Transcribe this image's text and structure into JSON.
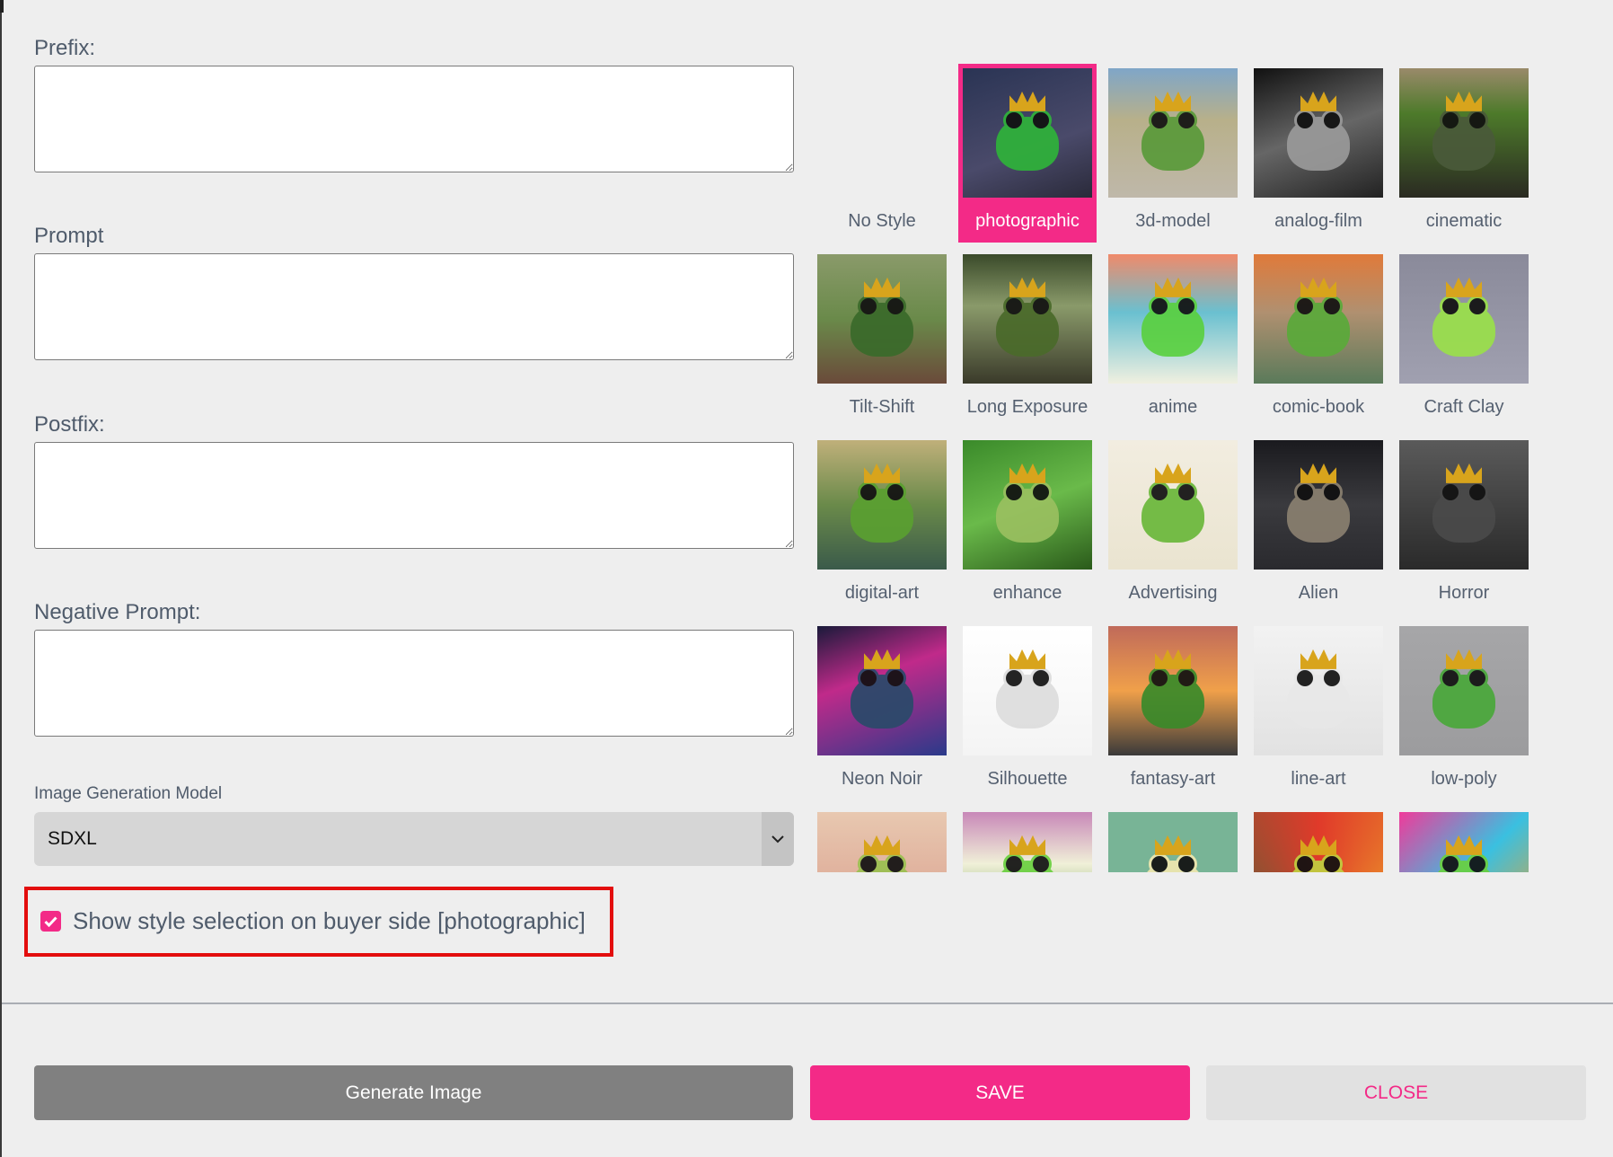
{
  "form": {
    "prefix_label": "Prefix:",
    "prefix_value": "",
    "prompt_label": "Prompt",
    "prompt_value": "",
    "postfix_label": "Postfix:",
    "postfix_value": "",
    "negative_label": "Negative Prompt:",
    "negative_value": "",
    "model_label": "Image Generation Model",
    "model_value": "SDXL",
    "show_style_checked": true,
    "show_style_label": "Show style selection on buyer side [photographic]"
  },
  "styles": {
    "selected": "photographic",
    "items": [
      {
        "label": "No Style",
        "has_image": false
      },
      {
        "label": "photographic",
        "has_image": true
      },
      {
        "label": "3d-model",
        "has_image": true
      },
      {
        "label": "analog-film",
        "has_image": true
      },
      {
        "label": "cinematic",
        "has_image": true
      },
      {
        "label": "Tilt-Shift",
        "has_image": true
      },
      {
        "label": "Long Exposure",
        "has_image": true
      },
      {
        "label": "anime",
        "has_image": true
      },
      {
        "label": "comic-book",
        "has_image": true
      },
      {
        "label": "Craft Clay",
        "has_image": true
      },
      {
        "label": "digital-art",
        "has_image": true
      },
      {
        "label": "enhance",
        "has_image": true
      },
      {
        "label": "Advertising",
        "has_image": true
      },
      {
        "label": "Alien",
        "has_image": true
      },
      {
        "label": "Horror",
        "has_image": true
      },
      {
        "label": "Neon Noir",
        "has_image": true
      },
      {
        "label": "Silhouette",
        "has_image": true
      },
      {
        "label": "fantasy-art",
        "has_image": true
      },
      {
        "label": "line-art",
        "has_image": true
      },
      {
        "label": "low-poly",
        "has_image": true
      },
      {
        "label": "",
        "has_image": true
      },
      {
        "label": "",
        "has_image": true
      },
      {
        "label": "",
        "has_image": true
      },
      {
        "label": "",
        "has_image": true
      },
      {
        "label": "",
        "has_image": true
      }
    ]
  },
  "footer": {
    "generate_label": "Generate Image",
    "save_label": "SAVE",
    "close_label": "CLOSE"
  },
  "colors": {
    "accent": "#f32a87",
    "highlight_box": "#e30d0d"
  }
}
